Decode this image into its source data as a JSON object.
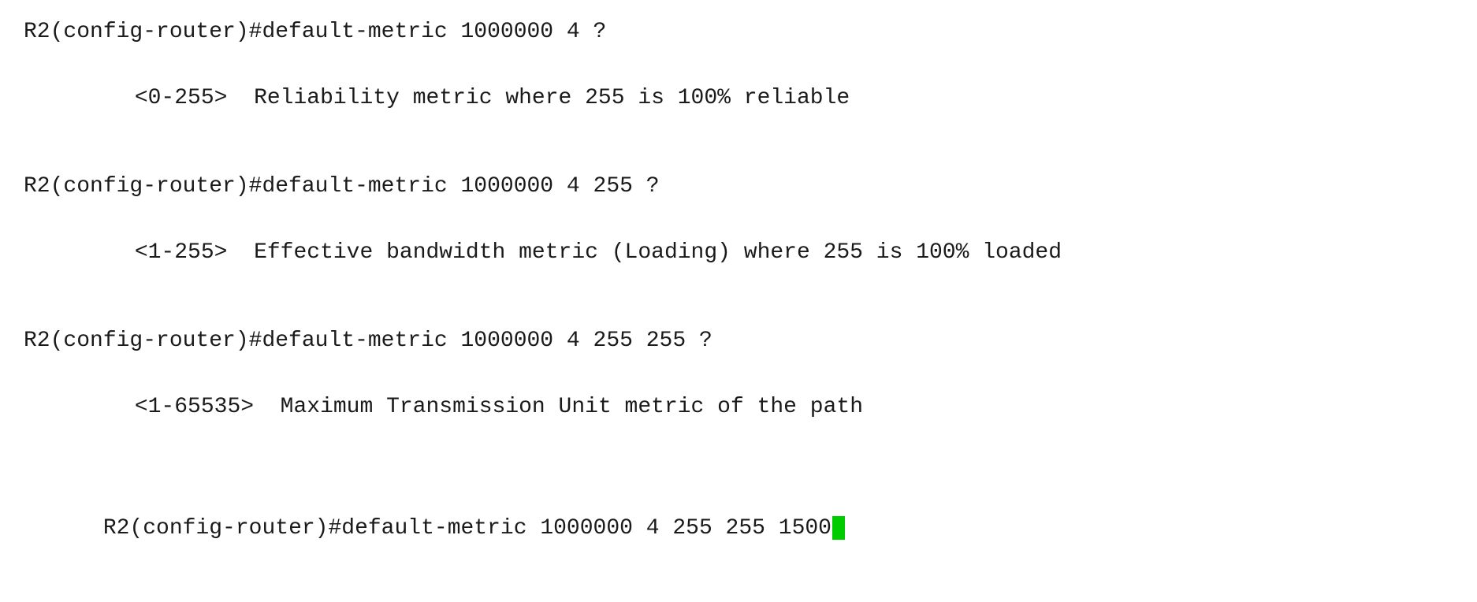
{
  "terminal": {
    "blocks": [
      {
        "command": "R2(config-router)#default-metric 1000000 4 ?",
        "help_range": "<0-255>",
        "help_desc": "Reliability metric where 255 is 100% reliable"
      },
      {
        "command": "R2(config-router)#default-metric 1000000 4 255 ?",
        "help_range": "<1-255>",
        "help_desc": "Effective bandwidth metric (Loading) where 255 is 100% loaded"
      },
      {
        "command": "R2(config-router)#default-metric 1000000 4 255 255 ?",
        "help_range": "<1-65535>",
        "help_desc": "Maximum Transmission Unit metric of the path"
      },
      {
        "command": "R2(config-router)#default-metric 1000000 4 255 255 1500",
        "help_range": null,
        "help_desc": null
      }
    ]
  }
}
